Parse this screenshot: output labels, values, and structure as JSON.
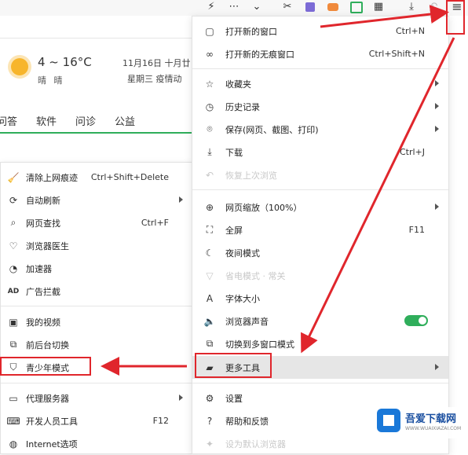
{
  "toolbar": {
    "icons": [
      "flash-icon",
      "more-icon",
      "chevron-down-icon",
      "scissors-icon",
      "extension-icon",
      "game-icon",
      "screen-icon",
      "apps-icon",
      "download-icon",
      "undo-icon",
      "menu-icon"
    ]
  },
  "weather": {
    "temp": "4 ~ 16°C",
    "condition": "晴 晴",
    "date": "11月16日  十月廿",
    "weekday": "星期三  疫情动"
  },
  "nav_tabs": [
    "问答",
    "软件",
    "问诊",
    "公益"
  ],
  "main_menu": [
    {
      "icon": "new-window-icon",
      "label": "打开新的窗口",
      "shortcut": "Ctrl+N"
    },
    {
      "icon": "incognito-icon",
      "label": "打开新的无痕窗口",
      "shortcut": "Ctrl+Shift+N"
    },
    {
      "icon": "star-icon",
      "label": "收藏夹",
      "arrow": true
    },
    {
      "icon": "history-icon",
      "label": "历史记录",
      "arrow": true
    },
    {
      "icon": "camera-icon",
      "label": "保存(网页、截图、打印)",
      "arrow": true
    },
    {
      "icon": "download-icon",
      "label": "下载",
      "shortcut": "Ctrl+J"
    },
    {
      "icon": "restore-icon",
      "label": "恢复上次浏览",
      "disabled": true
    },
    {
      "icon": "zoom-icon",
      "label": "网页缩放（100%）",
      "arrow": true
    },
    {
      "icon": "fullscreen-icon",
      "label": "全屏",
      "shortcut": "F11"
    },
    {
      "icon": "night-mode-icon",
      "label": "夜间模式"
    },
    {
      "icon": "cup-icon",
      "label": "省电模式 · 常关",
      "disabled": true
    },
    {
      "icon": "font-size-icon",
      "label": "字体大小"
    },
    {
      "icon": "speaker-icon",
      "label": "浏览器声音",
      "toggle": true
    },
    {
      "icon": "multi-window-icon",
      "label": "切换到多窗口模式"
    },
    {
      "icon": "toolbox-icon",
      "label": "更多工具",
      "arrow": true,
      "highlighted": true
    },
    {
      "icon": "gear-icon",
      "label": "设置"
    },
    {
      "icon": "help-icon",
      "label": "帮助和反馈",
      "arrow": true
    },
    {
      "icon": "bulb-icon",
      "label": "设为默认浏览器",
      "disabled": true
    }
  ],
  "sub_menu": [
    {
      "icon": "broom-icon",
      "label": "清除上网痕迹",
      "shortcut": "Ctrl+Shift+Delete"
    },
    {
      "icon": "refresh-icon",
      "label": "自动刷新",
      "arrow": true
    },
    {
      "icon": "find-icon",
      "label": "网页查找",
      "shortcut": "Ctrl+F"
    },
    {
      "icon": "doctor-icon",
      "label": "浏览器医生"
    },
    {
      "icon": "speedometer-icon",
      "label": "加速器"
    },
    {
      "icon": "ad-block-icon",
      "label": "广告拦截"
    },
    {
      "icon": "video-icon",
      "label": "我的视频"
    },
    {
      "icon": "switch-icon",
      "label": "前后台切换"
    },
    {
      "icon": "shield-icon",
      "label": "青少年模式"
    },
    {
      "icon": "proxy-icon",
      "label": "代理服务器",
      "arrow": true
    },
    {
      "icon": "devtools-icon",
      "label": "开发人员工具",
      "shortcut": "F12"
    },
    {
      "icon": "globe-icon",
      "label": "Internet选项"
    }
  ],
  "watermark": {
    "title": "吾爱下载网",
    "subtitle": "WWW.WUAIXIAZAI.COM"
  },
  "annotation_color": "#e0262c"
}
